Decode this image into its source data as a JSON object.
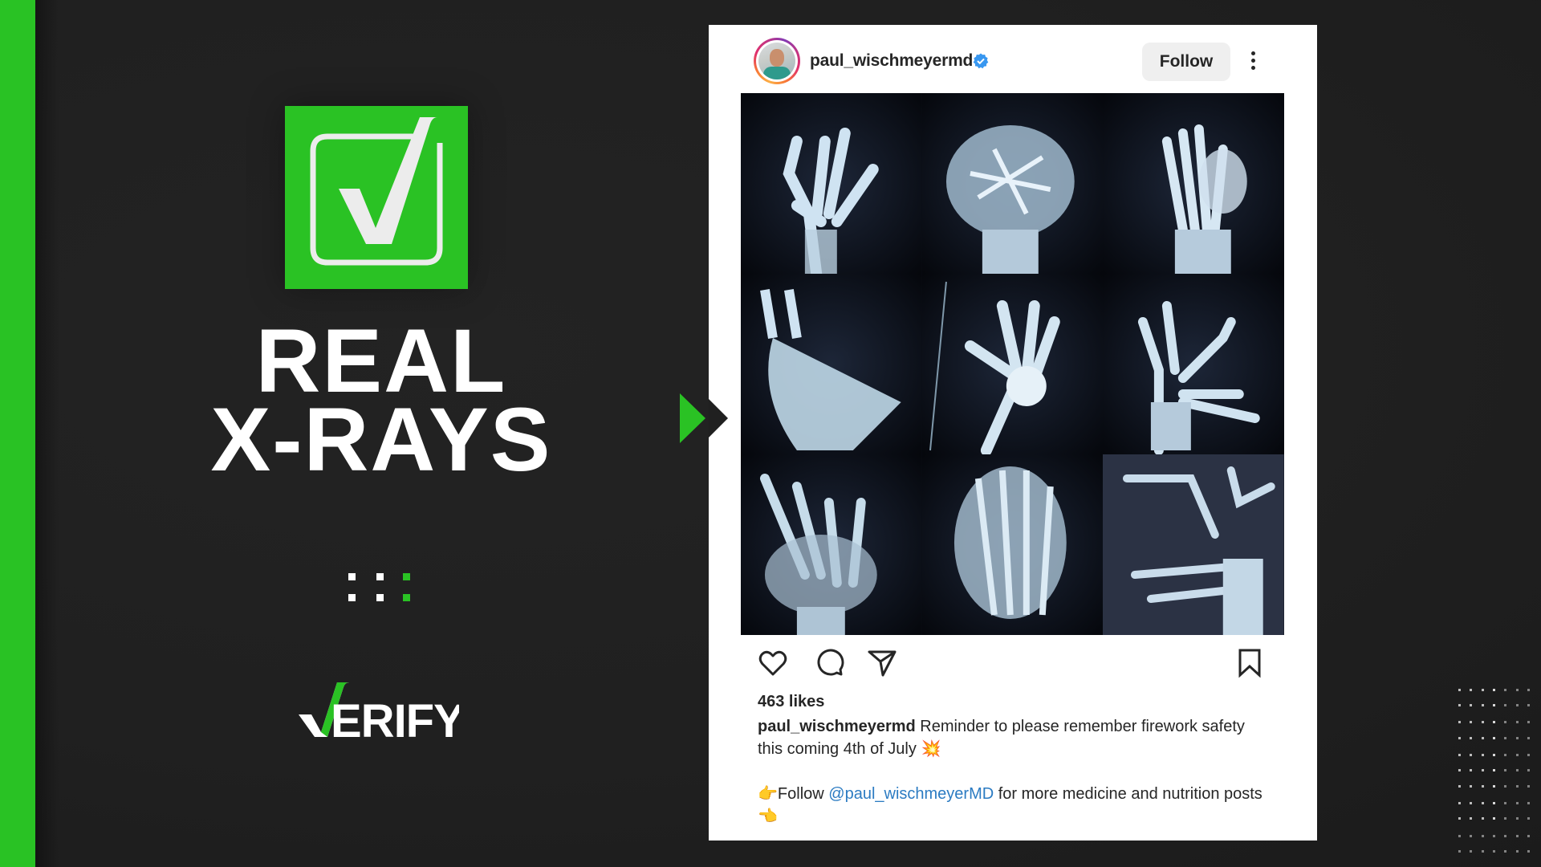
{
  "left_panel": {
    "verdict_icon": "checkbox-check-icon",
    "headline_line1": "REAL",
    "headline_line2": "X-RAYS",
    "pager": {
      "total_dots": 3,
      "active_dot": 3
    },
    "brand_logo": {
      "check_part": "√",
      "text": "ERIFY",
      "full": "VERIFY"
    }
  },
  "colors": {
    "brand_green": "#2ac224",
    "background": "#202020",
    "mention_blue": "#2b7bc2",
    "verified_blue": "#3897f0"
  },
  "post": {
    "username": "paul_wischmeyermd",
    "verified": true,
    "follow_label": "Follow",
    "more_icon": "more-vertical-icon",
    "image_alt": "3x3 grid of hand X-rays showing firework injuries",
    "image_tiles": [
      "x-ray-1",
      "x-ray-2",
      "x-ray-3",
      "x-ray-4",
      "x-ray-5",
      "x-ray-6",
      "x-ray-7",
      "x-ray-8",
      "x-ray-9"
    ],
    "actions": {
      "like_icon": "heart-icon",
      "comment_icon": "comment-icon",
      "share_icon": "send-icon",
      "save_icon": "bookmark-icon"
    },
    "likes_text": "463 likes",
    "caption": {
      "author": "paul_wischmeyermd",
      "text1": " Reminder to please remember firework safety this coming 4th of July ",
      "emoji1": "💥",
      "emoji2": "👉",
      "text2": "Follow ",
      "mention": "@paul_wischmeyerMD",
      "text3": " for more medicine and nutrition posts",
      "emoji3": "👈"
    }
  }
}
